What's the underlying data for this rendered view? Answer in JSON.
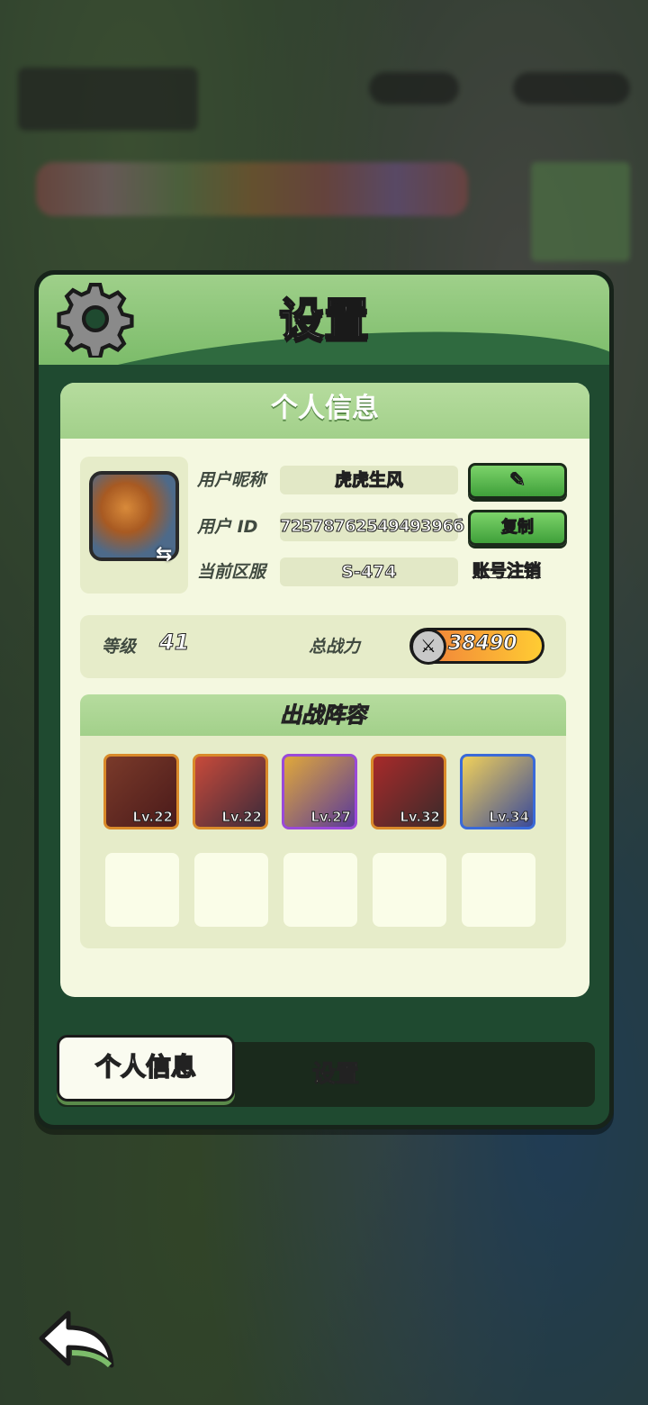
{
  "window_title": "设置",
  "profile_section": {
    "title": "个人信息",
    "nickname_label": "用户昵称",
    "nickname_value": "虎虎生风",
    "id_label": "用户 ID",
    "id_value": "7257876254949396б",
    "server_label": "当前区服",
    "server_value": "S-474",
    "copy_label": "复制",
    "cancel_account_label": "账号注销"
  },
  "stats": {
    "level_label": "等级",
    "level_value": "41",
    "power_label": "总战力",
    "power_value": "38490"
  },
  "lineup": {
    "title": "出战阵容",
    "heroes": [
      {
        "level": "Lv.22",
        "border": "#d98a2a"
      },
      {
        "level": "Lv.22",
        "border": "#d98a2a"
      },
      {
        "level": "Lv.27",
        "border": "#9a4ad8"
      },
      {
        "level": "Lv.32",
        "border": "#d98a2a"
      },
      {
        "level": "Lv.34",
        "border": "#3a6ad8"
      }
    ],
    "empty_slots": 5
  },
  "tabs": [
    {
      "label": "个人信息",
      "active": true
    },
    {
      "label": "设置",
      "active": false
    }
  ],
  "icons": [
    "gear-icon",
    "edit-icon",
    "swap-icon",
    "power-icon",
    "back-arrow-icon"
  ],
  "colors": {
    "accent_green": "#7cbc6a",
    "panel_dark": "#1f4a30",
    "card_bg": "#f4f8e0"
  }
}
